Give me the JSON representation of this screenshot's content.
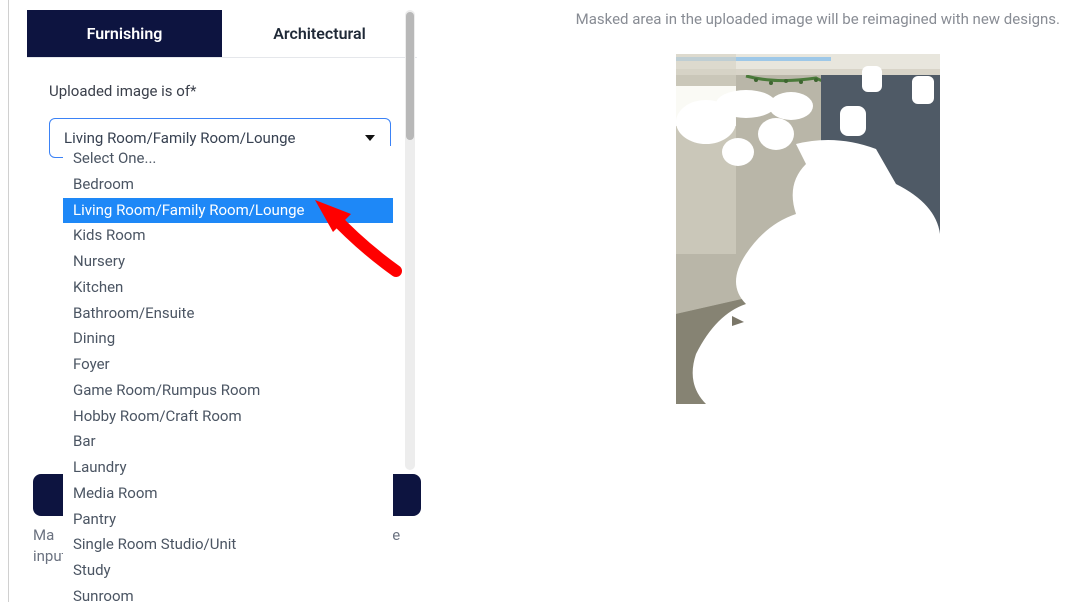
{
  "tabs": {
    "furnishing": "Furnishing",
    "architectural": "Architectural"
  },
  "form": {
    "label": "Uploaded image is of*",
    "selected_value": "Living Room/Family Room/Lounge"
  },
  "dropdown": {
    "options": [
      "Select One...",
      "Bedroom",
      "Living Room/Family Room/Lounge",
      "Kids Room",
      "Nursery",
      "Kitchen",
      "Bathroom/Ensuite",
      "Dining",
      "Foyer",
      "Game Room/Rumpus Room",
      "Hobby Room/Craft Room",
      "Bar",
      "Laundry",
      "Media Room",
      "Pantry",
      "Single Room Studio/Unit",
      "Study",
      "Sunroom"
    ],
    "highlighted_index": 2
  },
  "helper_text_1": "Ma",
  "helper_text_2": "e",
  "helper_text_3": "inputs.",
  "instruction": "Masked area in the uploaded image will be reimagined with new designs."
}
